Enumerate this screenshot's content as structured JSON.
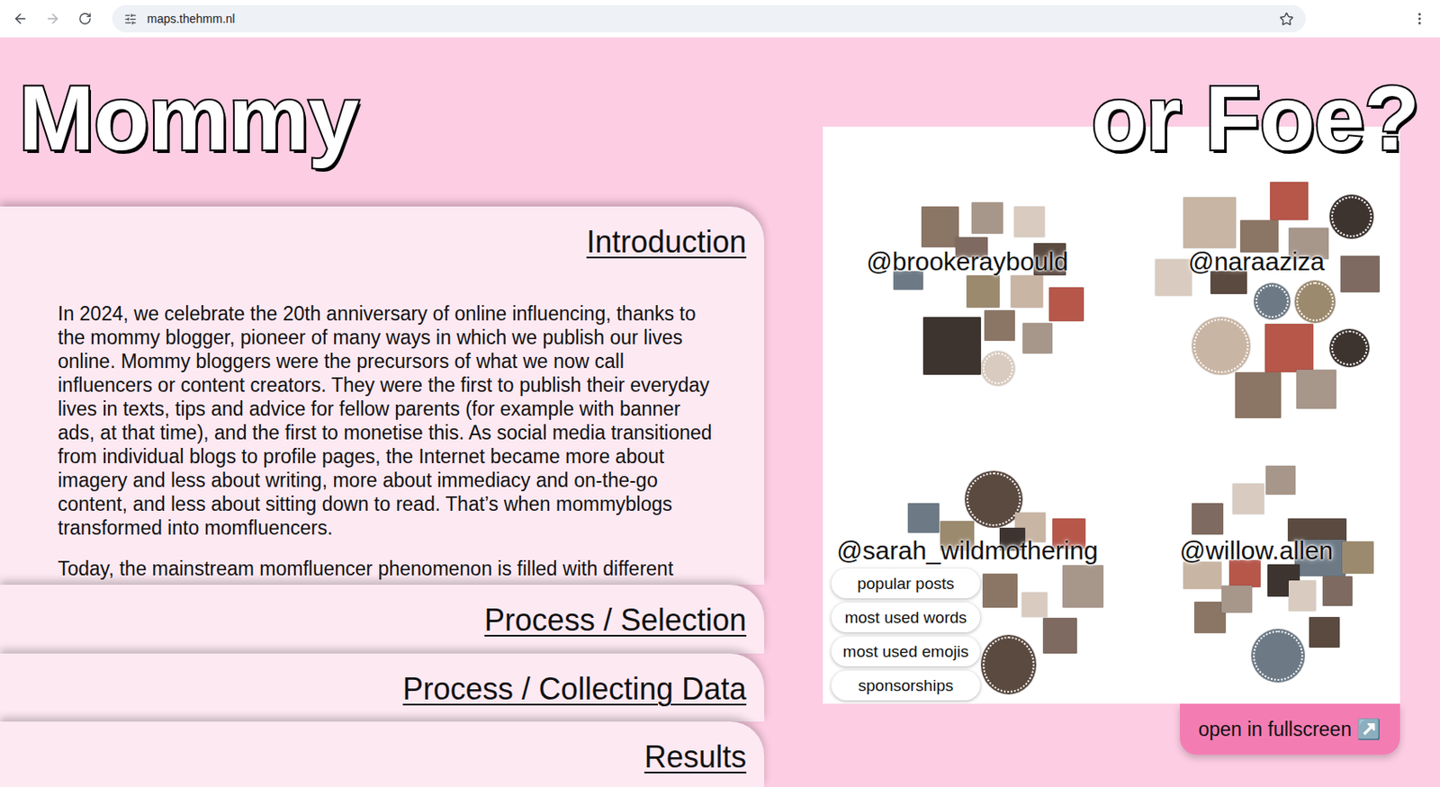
{
  "browser": {
    "url": "maps.thehmm.nl"
  },
  "header": {
    "title_left": "Mommy",
    "title_right": "or Foe?"
  },
  "sections": [
    {
      "title": "Introduction",
      "expanded": true,
      "paragraphs": [
        "In 2024, we celebrate the 20th anniversary of online influencing, thanks to the mommy blogger, pioneer of many ways in which we publish our lives online. Mommy bloggers were the precursors of what we now call influencers or content creators. They were the first to publish their everyday lives in texts, tips and advice for fellow parents (for example with banner ads, at that time), and the first to monetise this. As social media transitioned from individual blogs to profile pages, the Internet became more about imagery and less about writing, more about immediacy and on-the-go content, and less about sitting down to read. That’s when mommyblogs transformed into momfluencers.",
        "Today, the mainstream momfluencer phenomenon is filled with different"
      ]
    },
    {
      "title": "Process / Selection",
      "expanded": false,
      "paragraphs": []
    },
    {
      "title": "Process / Collecting Data",
      "expanded": false,
      "paragraphs": []
    },
    {
      "title": "Results",
      "expanded": false,
      "paragraphs": []
    }
  ],
  "map": {
    "clusters": [
      {
        "handle": "@brookeraybould"
      },
      {
        "handle": "@naraaziza"
      },
      {
        "handle": "@sarah_wildmothering"
      },
      {
        "handle": "@willow.allen"
      }
    ],
    "filters": [
      {
        "label": "popular posts"
      },
      {
        "label": "most used words"
      },
      {
        "label": "most used emojis"
      },
      {
        "label": "sponsorships"
      }
    ],
    "fullscreen_button": "open in fullscreen ↗️"
  }
}
